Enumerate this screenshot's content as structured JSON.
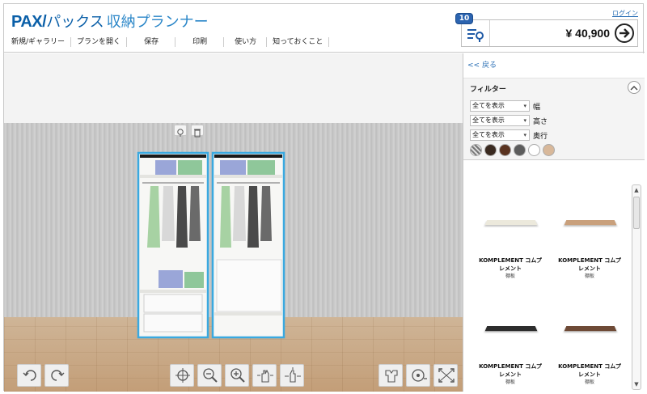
{
  "header": {
    "brand_pax": "PAX/",
    "brand_kana": "パックス",
    "brand_sub": "収納プランナー",
    "login": "ログイン",
    "menu": [
      "新規/ギャラリー",
      "プランを開く",
      "保存",
      "印刷",
      "使い方",
      "知っておくこと"
    ],
    "cart_count": "10",
    "price": "¥ 40,900"
  },
  "panel": {
    "back": "<< 戻る",
    "filter_title": "フィルター",
    "filters": [
      {
        "value": "全てを表示",
        "label": "幅"
      },
      {
        "value": "全てを表示",
        "label": "高さ"
      },
      {
        "value": "全てを表示",
        "label": "奥行"
      }
    ],
    "swatches": [
      "#9a9a9a",
      "#3a2a20",
      "#5a3320",
      "#5c5c5c",
      "#ffffff",
      "#d8b89a"
    ],
    "products": [
      {
        "name": "KOMPLEMENT コムプ",
        "name2": "レメント",
        "tag": "棚板",
        "color": "#ece9dc"
      },
      {
        "name": "KOMPLEMENT コムプ",
        "name2": "レメント",
        "tag": "棚板",
        "color": "#c9a07c"
      },
      {
        "name": "KOMPLEMENT コムプ",
        "name2": "レメント",
        "tag": "棚板",
        "color": "#2d2d2d"
      },
      {
        "name": "KOMPLEMENT コムプ",
        "name2": "レメント",
        "tag": "棚板",
        "color": "#6e4a36"
      }
    ]
  },
  "colors": {
    "accent": "#0a5fa8",
    "selection": "#3aa9e0"
  }
}
